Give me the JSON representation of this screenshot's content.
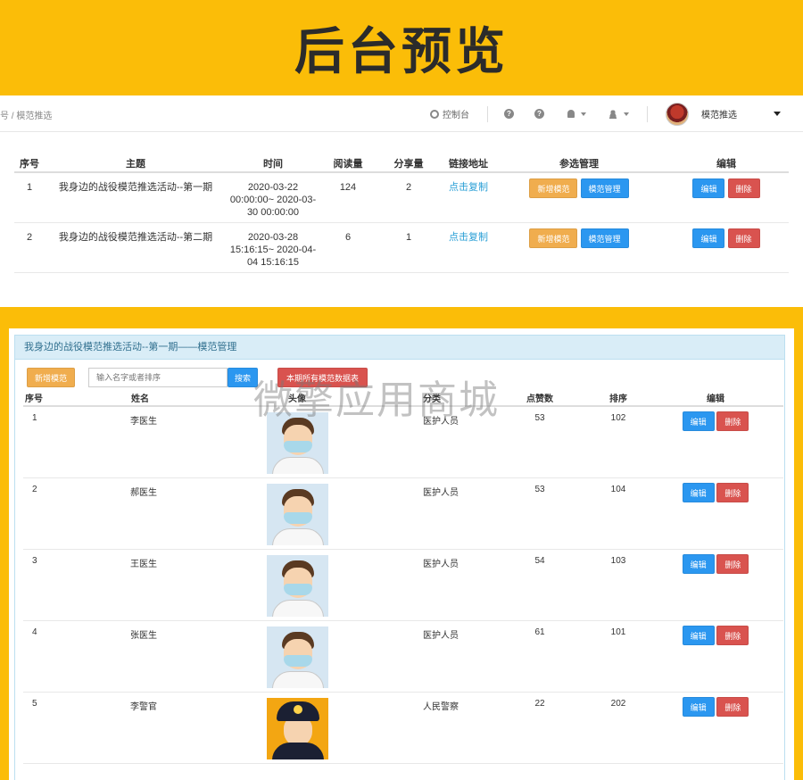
{
  "banner": {
    "title": "后台预览"
  },
  "topnav": {
    "breadcrumb": "号 / 模范推选",
    "console": "控制台",
    "username": "模范推选"
  },
  "activity_table": {
    "headers": [
      "序号",
      "主题",
      "时间",
      "阅读量",
      "分享量",
      "链接地址",
      "参选管理",
      "编辑"
    ],
    "rows": [
      {
        "index": "1",
        "topic": "我身边的战役模范推选活动--第一期",
        "time": "2020-03-22 00:00:00~ 2020-03-30 00:00:00",
        "reads": "124",
        "shares": "2",
        "link": "点击复制",
        "add_label": "新增模范",
        "manage_label": "模范管理",
        "edit_label": "编辑",
        "delete_label": "删除"
      },
      {
        "index": "2",
        "topic": "我身边的战役模范推选活动--第二期",
        "time": "2020-03-28 15:16:15~ 2020-04-04 15:16:15",
        "reads": "6",
        "shares": "1",
        "link": "点击复制",
        "add_label": "新增模范",
        "manage_label": "模范管理",
        "edit_label": "编辑",
        "delete_label": "删除"
      }
    ]
  },
  "manage_panel": {
    "title": "我身边的战役模范推选活动--第一期——模范管理",
    "add_label": "新增模范",
    "search_placeholder": "输入名字或者排序",
    "search_label": "搜索",
    "export_label": "本期所有模范数据表",
    "headers": [
      "序号",
      "姓名",
      "头像",
      "分类",
      "点赞数",
      "排序",
      "编辑"
    ],
    "rows": [
      {
        "index": "1",
        "name": "李医生",
        "avatar": "doctor-avatar",
        "category": "医护人员",
        "likes": "53",
        "order": "102",
        "edit_label": "编辑",
        "delete_label": "删除"
      },
      {
        "index": "2",
        "name": "郝医生",
        "avatar": "doctor-avatar",
        "category": "医护人员",
        "likes": "53",
        "order": "104",
        "edit_label": "编辑",
        "delete_label": "删除"
      },
      {
        "index": "3",
        "name": "王医生",
        "avatar": "doctor-avatar",
        "category": "医护人员",
        "likes": "54",
        "order": "103",
        "edit_label": "编辑",
        "delete_label": "删除"
      },
      {
        "index": "4",
        "name": "张医生",
        "avatar": "doctor-avatar",
        "category": "医护人员",
        "likes": "61",
        "order": "101",
        "edit_label": "编辑",
        "delete_label": "删除"
      },
      {
        "index": "5",
        "name": "李警官",
        "avatar": "police-avatar",
        "category": "人民警察",
        "likes": "22",
        "order": "202",
        "edit_label": "编辑",
        "delete_label": "删除"
      }
    ]
  },
  "watermark": "微擎应用商城",
  "colors": {
    "banner_bg": "#fbbd08",
    "primary": "#2b97f0",
    "warning": "#f0ad4e",
    "danger": "#d9534f",
    "link": "#2a9fd6"
  }
}
